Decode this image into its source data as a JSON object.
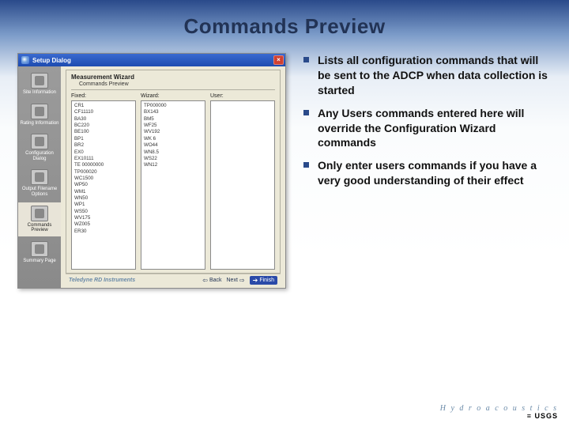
{
  "slide_title": "Commands Preview",
  "bullets": {
    "b1": "Lists all configuration commands that will be sent to the ADCP when data collection is started",
    "b2": "Any Users commands entered here will override the Configuration Wizard commands",
    "b3": "Only enter users commands if you have a very good understanding of their effect"
  },
  "dialog": {
    "title": "Setup Dialog",
    "wizard_title": "Measurement Wizard",
    "subtitle": "Commands Preview",
    "footer_brand": "Teledyne RD Instruments",
    "nav": {
      "back": "Back",
      "next": "Next",
      "finish": "Finish"
    }
  },
  "sidebar": {
    "items": {
      "site": "Site Information",
      "rating": "Rating Information",
      "config": "Configuration Dialog",
      "output": "Output Filename Options",
      "commands": "Commands Preview",
      "summary": "Summary Page"
    }
  },
  "columns": {
    "fixed": {
      "label": "Fixed:",
      "lines": "CR1\nCF11110\nBA30\nBC220\nBE100\nBP1\nBR2\nEX0\nEX10111\nTE 00000000\nTP000020\nWC1500\nWP50\nWM1\nWN50\nWP1\nWS50\nWV175\nWZ005\nER30"
    },
    "wizard": {
      "label": "Wizard:",
      "lines": "TP000000\nBX143\nBM5\nWF25\nWV192\nWK 6\nWO44\nWN8.5\nWS22\nWN12"
    },
    "user": {
      "label": "User:",
      "lines": ""
    }
  },
  "branding": {
    "hydro": "H y d r o a c o u s t i c s",
    "usgs": "≡ USGS"
  }
}
